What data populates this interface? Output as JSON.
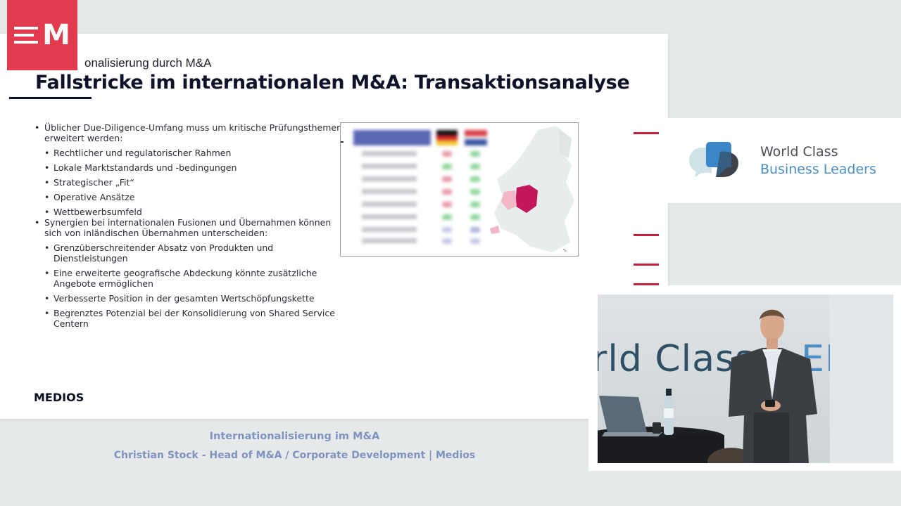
{
  "logo": {
    "letter": "M"
  },
  "slide": {
    "kicker": "onalisierung durch M&A",
    "title": "Fallstricke im internationalen M&A: Transaktionsanalyse",
    "group1": {
      "lead": "Üblicher Due-Diligence-Umfang muss um kritische Prüfungsthemen erweitert werden:",
      "items": [
        "Rechtlicher und regulatorischer Rahmen",
        "Lokale Marktstandards und -bedingungen",
        "Strategischer „Fit“",
        "Operative Ansätze",
        "Wettbewerbsumfeld"
      ]
    },
    "group2": {
      "lead": "Synergien bei internationalen Fusionen und Übernahmen können sich von inländischen Übernahmen unterscheiden:",
      "items": [
        "Grenzüberschreitender Absatz von Produkten und Dienstleistungen",
        "Eine erweiterte geografische Abdeckung könnte zusätzliche Angebote ermöglichen",
        "Verbesserte Position in der gesamten Wertschöpfungskette",
        "Begrenztes Potenzial bei der Konsolidierung von Shared Service Centern"
      ]
    },
    "footer_brand": "MEDIOS"
  },
  "brand_card": {
    "line1": "World Class",
    "line2": "Business Leaders",
    "colors": {
      "line1": "#4b4f58",
      "line2": "#4a8fc8"
    }
  },
  "video": {
    "backdrop_dark": "rld Class",
    "backdrop_blue": "ERIES"
  },
  "captions": {
    "talk_title": "Internationalisierung im M&A",
    "speaker": "Christian Stock - Head of M&A / Corporate Development | Medios"
  },
  "colors": {
    "accent_red": "#e23b4e",
    "caption_blue": "#7f93c0",
    "title_navy": "#0f1228"
  }
}
